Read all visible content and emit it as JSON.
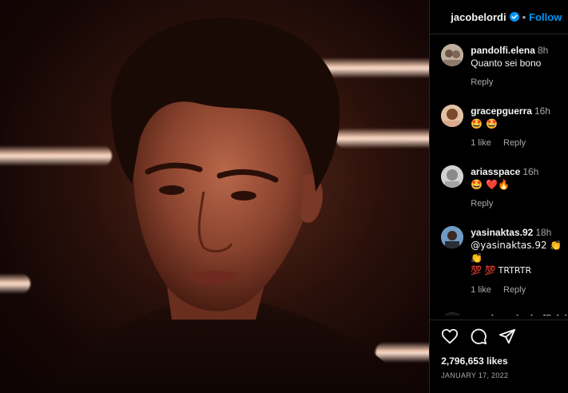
{
  "post": {
    "username": "jacobelordi",
    "separator": "•",
    "follow_label": "Follow",
    "likes": "2,796,653 likes",
    "date": "JANUARY 17, 2022"
  },
  "comments": [
    {
      "user": "pandolfi.elena",
      "time": "8h",
      "text": "Quanto sei bono",
      "reply": "Reply"
    },
    {
      "user": "gracepguerra",
      "time": "16h",
      "text": "🤩 🤩",
      "likes": "1 like",
      "reply": "Reply"
    },
    {
      "user": "ariasspace",
      "time": "16h",
      "text": "🤩 ❤️🔥",
      "reply": "Reply"
    },
    {
      "user": "yasinaktas.92",
      "time": "18h",
      "text": "@yasinaktas.92 👏👏",
      "text2": "💯 💯 TRTRTR",
      "likes": "1 like",
      "reply": "Reply"
    },
    {
      "user": "moniquesinghofficial",
      "text": "❤️"
    }
  ],
  "icons": [
    "heart-icon",
    "comment-icon",
    "share-icon"
  ],
  "colors": {
    "accent": "#0095f6",
    "verified": "#0095f6",
    "muted": "#a8a8a8"
  }
}
